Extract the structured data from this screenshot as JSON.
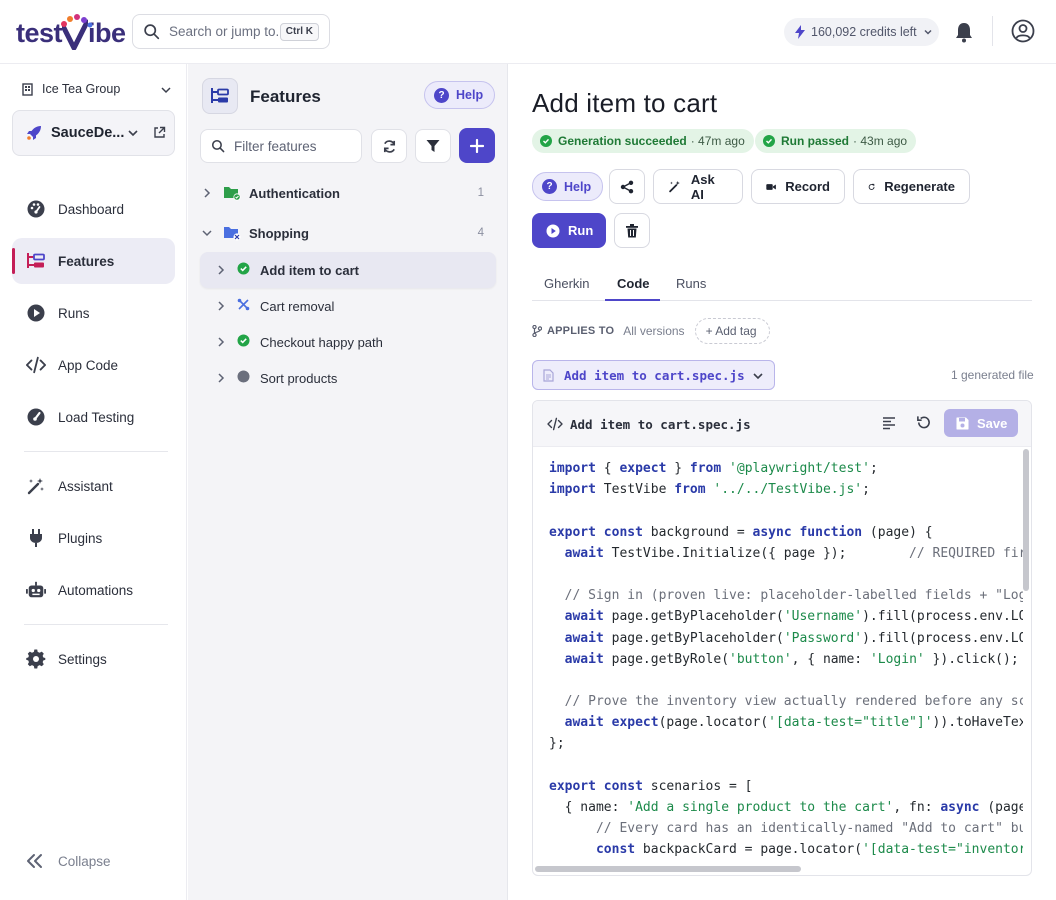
{
  "app": {
    "logo_part1": "test",
    "logo_part2": "ibe",
    "search_placeholder": "Search or jump to.",
    "search_shortcut": "Ctrl K",
    "credits": "160,092 credits left",
    "accent_color": "#4e46c9",
    "brand_color": "#3a2f7a"
  },
  "sidebar": {
    "org": "Ice Tea Group",
    "project": "SauceDe...",
    "items": [
      {
        "label": "Dashboard",
        "icon": "gauge-icon"
      },
      {
        "label": "Features",
        "icon": "features-icon",
        "active": true
      },
      {
        "label": "Runs",
        "icon": "play-circle-icon"
      },
      {
        "label": "App Code",
        "icon": "code-icon"
      },
      {
        "label": "Load Testing",
        "icon": "speedometer-icon"
      },
      {
        "label": "Assistant",
        "icon": "magic-wand-icon"
      },
      {
        "label": "Plugins",
        "icon": "plug-icon"
      },
      {
        "label": "Automations",
        "icon": "robot-icon"
      },
      {
        "label": "Settings",
        "icon": "gear-icon"
      }
    ],
    "collapse": "Collapse"
  },
  "features": {
    "title": "Features",
    "help": "Help",
    "filter_placeholder": "Filter features",
    "groups": [
      {
        "name": "Authentication",
        "count": "1",
        "expanded": false
      },
      {
        "name": "Shopping",
        "count": "4",
        "expanded": true
      }
    ],
    "items": [
      {
        "name": "Add item to cart",
        "status": "passed",
        "selected": true
      },
      {
        "name": "Cart removal",
        "status": "generating"
      },
      {
        "name": "Checkout happy path",
        "status": "passed"
      },
      {
        "name": "Sort products",
        "status": "not-run"
      }
    ]
  },
  "main": {
    "title": "Add item to cart",
    "badges": [
      {
        "label": "Generation succeeded",
        "ago": "· 47m ago"
      },
      {
        "label": "Run passed",
        "ago": "· 43m ago"
      }
    ],
    "buttons": {
      "help": "Help",
      "ask_ai": "Ask AI",
      "record": "Record",
      "regenerate": "Regenerate",
      "run": "Run"
    },
    "tabs": [
      "Gherkin",
      "Code",
      "Runs"
    ],
    "active_tab": "Code",
    "applies_to_label": "APPLIES TO",
    "applies_to_value": "All versions",
    "add_tag": "+ Add tag",
    "file_select": "Add item to cart.spec.js",
    "generated_count": "1 generated file",
    "code_file": "Add item to cart.spec.js",
    "save": "Save"
  },
  "code_lines": [
    [
      [
        "kw",
        "import"
      ],
      [
        "t",
        " { "
      ],
      [
        "kw",
        "expect"
      ],
      [
        "t",
        " } "
      ],
      [
        "kw",
        "from"
      ],
      [
        "t",
        " "
      ],
      [
        "str",
        "'@playwright/test'"
      ],
      [
        "t",
        ";"
      ]
    ],
    [
      [
        "kw",
        "import"
      ],
      [
        "t",
        " TestVibe "
      ],
      [
        "kw",
        "from"
      ],
      [
        "t",
        " "
      ],
      [
        "str",
        "'../../TestVibe.js'"
      ],
      [
        "t",
        ";"
      ]
    ],
    [],
    [
      [
        "kw",
        "export"
      ],
      [
        "t",
        " "
      ],
      [
        "kw",
        "const"
      ],
      [
        "t",
        " background = "
      ],
      [
        "kw",
        "async"
      ],
      [
        "t",
        " "
      ],
      [
        "kw",
        "function"
      ],
      [
        "t",
        " (page) {"
      ]
    ],
    [
      [
        "t",
        "  "
      ],
      [
        "kw",
        "await"
      ],
      [
        "t",
        " TestVibe.Initialize({ page });        "
      ],
      [
        "cm",
        "// REQUIRED first"
      ]
    ],
    [],
    [
      [
        "t",
        "  "
      ],
      [
        "cm",
        "// Sign in (proven live: placeholder-labelled fields + \"Login"
      ]
    ],
    [
      [
        "t",
        "  "
      ],
      [
        "kw",
        "await"
      ],
      [
        "t",
        " page.getByPlaceholder("
      ],
      [
        "str",
        "'Username'"
      ],
      [
        "t",
        ").fill(process.env.LOGI"
      ]
    ],
    [
      [
        "t",
        "  "
      ],
      [
        "kw",
        "await"
      ],
      [
        "t",
        " page.getByPlaceholder("
      ],
      [
        "str",
        "'Password'"
      ],
      [
        "t",
        ").fill(process.env.LOGI"
      ]
    ],
    [
      [
        "t",
        "  "
      ],
      [
        "kw",
        "await"
      ],
      [
        "t",
        " page.getByRole("
      ],
      [
        "str",
        "'button'"
      ],
      [
        "t",
        ", { name: "
      ],
      [
        "str",
        "'Login'"
      ],
      [
        "t",
        " }).click();"
      ]
    ],
    [],
    [
      [
        "t",
        "  "
      ],
      [
        "cm",
        "// Prove the inventory view actually rendered before any scen"
      ]
    ],
    [
      [
        "t",
        "  "
      ],
      [
        "kw",
        "await"
      ],
      [
        "t",
        " "
      ],
      [
        "kw",
        "expect"
      ],
      [
        "t",
        "(page.locator("
      ],
      [
        "str",
        "'[data-test=\"title\"]'"
      ],
      [
        "t",
        ")).toHaveText("
      ]
    ],
    [
      [
        "t",
        "};"
      ]
    ],
    [],
    [
      [
        "kw",
        "export"
      ],
      [
        "t",
        " "
      ],
      [
        "kw",
        "const"
      ],
      [
        "t",
        " scenarios = ["
      ]
    ],
    [
      [
        "t",
        "  { name: "
      ],
      [
        "str",
        "'Add a single product to the cart'"
      ],
      [
        "t",
        ", fn: "
      ],
      [
        "kw",
        "async"
      ],
      [
        "t",
        " (page)"
      ]
    ],
    [
      [
        "t",
        "      "
      ],
      [
        "cm",
        "// Every card has an identically-named \"Add to cart\" butt"
      ]
    ],
    [
      [
        "t",
        "      "
      ],
      [
        "kw",
        "const"
      ],
      [
        "t",
        " backpackCard = page.locator("
      ],
      [
        "str",
        "'[data-test=\"inventory-"
      ]
    ]
  ]
}
